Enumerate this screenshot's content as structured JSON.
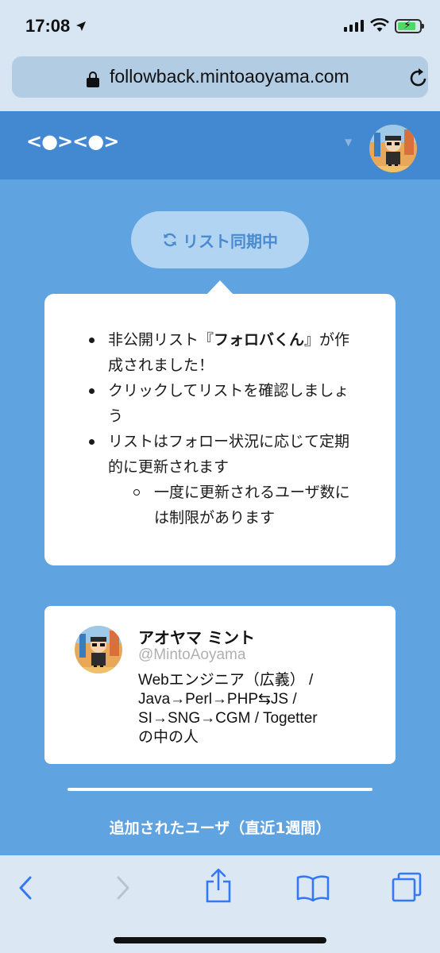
{
  "status_bar": {
    "time": "17:08"
  },
  "browser": {
    "url": "followback.mintoaoyama.com"
  },
  "app": {
    "logo": "<●><●>",
    "sync_label": "リスト同期中"
  },
  "info": {
    "items": [
      {
        "pre": "非公開リスト『",
        "bold": "フォロバくん",
        "post": "』が作成されました！"
      },
      {
        "text": "クリックしてリストを確認しましょう"
      },
      {
        "text": "リストはフォロー状況に応じて定期的に更新されます"
      }
    ],
    "sub_item": "一度に更新されるユーザ数には制限があります"
  },
  "profile": {
    "name": "アオヤマ ミント",
    "handle": "@MintoAoyama",
    "bio_lines": [
      "Webエンジニア（広義） /",
      "Java→Perl→PHP⇆JS /",
      "SI→SNG→CGM / Togetter",
      "の中の人"
    ]
  },
  "section": {
    "title": "追加されたユーザ（直近1週間）"
  },
  "colors": {
    "page_bg": "#5fa3e1",
    "header_bg": "#4389d1",
    "chrome_bg": "#d8e6f3",
    "accent": "#4a8bd0"
  },
  "icons": {
    "back": "chevron-left-icon",
    "forward": "chevron-right-icon",
    "share": "share-icon",
    "bookmarks": "book-icon",
    "tabs": "tabs-icon",
    "reload": "reload-icon",
    "lock": "lock-icon",
    "sync": "sync-icon"
  }
}
